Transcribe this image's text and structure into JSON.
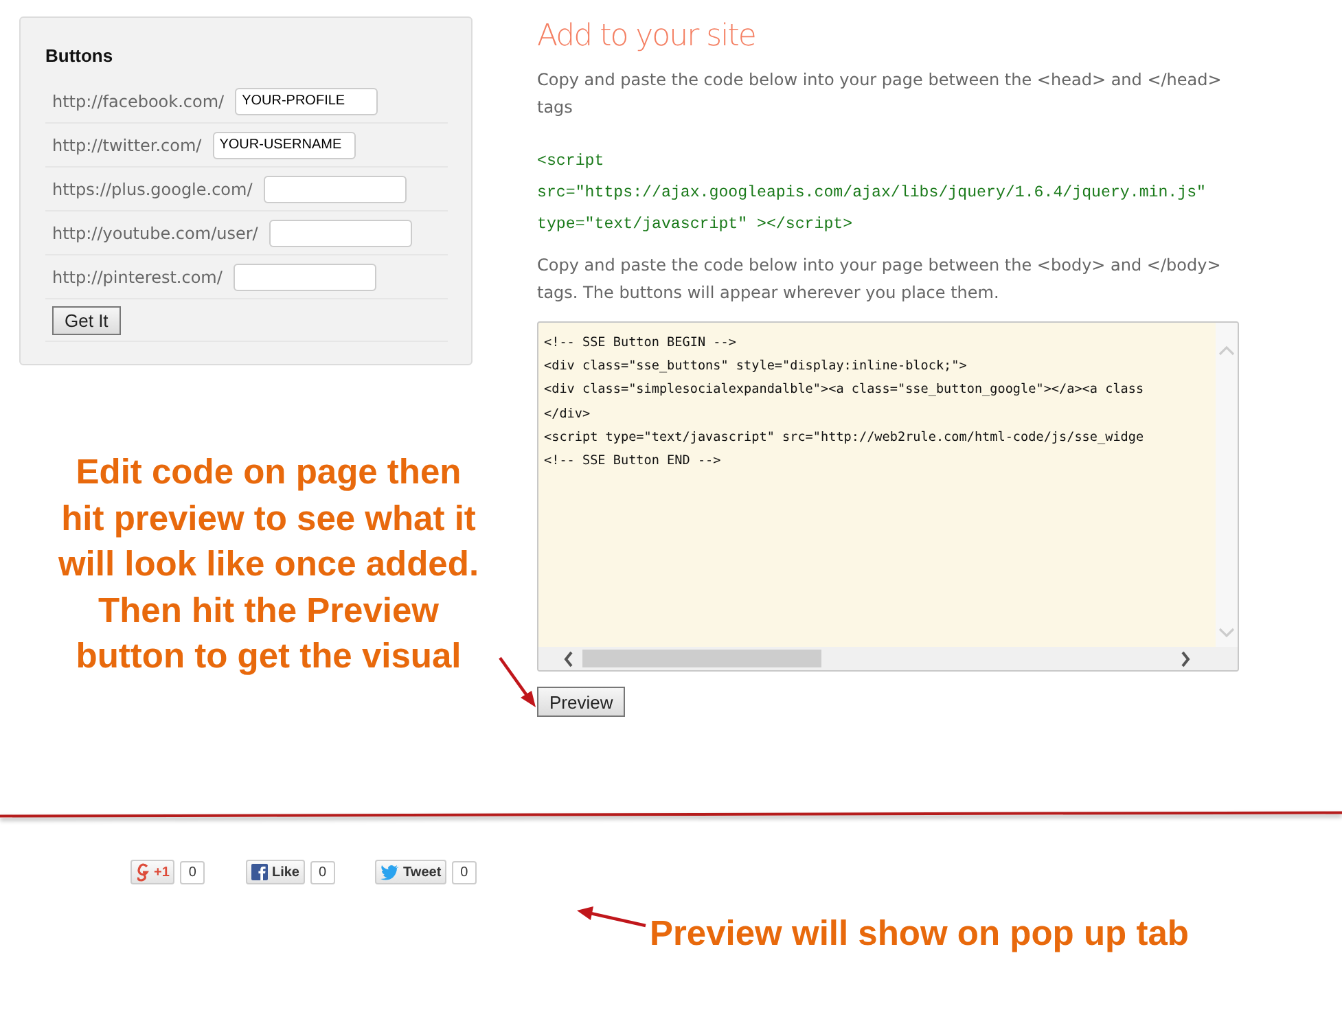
{
  "form": {
    "title": "Buttons",
    "rows": [
      {
        "label": "http://facebook.com/",
        "value": "YOUR-PROFILE"
      },
      {
        "label": "http://twitter.com/",
        "value": "YOUR-USERNAME"
      },
      {
        "label": "https://plus.google.com/",
        "value": ""
      },
      {
        "label": "http://youtube.com/user/",
        "value": ""
      },
      {
        "label": "http://pinterest.com/",
        "value": ""
      }
    ],
    "button": "Get It"
  },
  "embed": {
    "title": "Add to your site",
    "head_instructions": "Copy and paste the code below into your page between the <head> and </head> tags",
    "head_code": [
      "<script",
      "src=\"https://ajax.googleapis.com/ajax/libs/jquery/1.6.4/jquery.min.js\"",
      "type=\"text/javascript\" ></script>"
    ],
    "body_instructions": "Copy and paste the code below into your page between the <body> and </body> tags. The buttons will appear wherever you place them.",
    "code_lines": [
      "<!-- SSE Button BEGIN -->",
      "<div class=\"sse_buttons\" style=\"display:inline-block;\">",
      "<div class=\"simplesocialexpandalble\"><a class=\"sse_button_google\"></a><a class",
      "</div>",
      "<script type=\"text/javascript\" src=\"http://web2rule.com/html-code/js/sse_widge",
      "<!-- SSE Button END -->"
    ],
    "button": "Preview"
  },
  "preview_buttons": [
    {
      "kind": "google",
      "label": "+1",
      "count": "0"
    },
    {
      "kind": "facebook",
      "label": "Like",
      "count": "0"
    },
    {
      "kind": "twitter",
      "label": "Tweet",
      "count": "0"
    }
  ],
  "annotations": [
    {
      "kind": "edit",
      "lines": [
        "Edit code on page then",
        "hit preview to see what it",
        "will look like once added.",
        "Then hit the Preview",
        "button to get the visual"
      ]
    },
    {
      "kind": "popup",
      "lines": [
        "Preview will show on pop up tab"
      ]
    }
  ]
}
